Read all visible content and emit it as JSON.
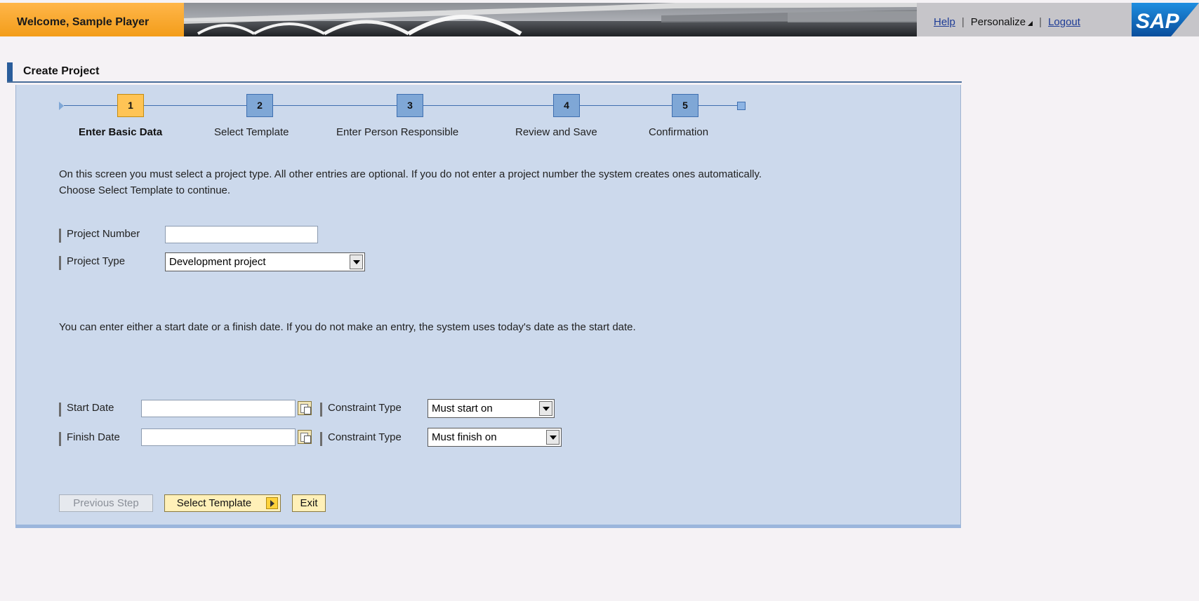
{
  "header": {
    "welcome": "Welcome, Sample Player",
    "links": {
      "help": "Help",
      "personalize": "Personalize",
      "logout": "Logout"
    },
    "logo_text": "SAP"
  },
  "page": {
    "title": "Create Project"
  },
  "roadmap": {
    "current_step": 1,
    "steps": [
      {
        "number": "1",
        "label": "Enter Basic Data"
      },
      {
        "number": "2",
        "label": "Select Template"
      },
      {
        "number": "3",
        "label": "Enter Person Responsible"
      },
      {
        "number": "4",
        "label": "Review and Save"
      },
      {
        "number": "5",
        "label": "Confirmation"
      }
    ]
  },
  "intro": {
    "line1": "On this screen you must select a project type. All other entries are optional. If you do not enter a project number the system creates ones automatically.",
    "line2": "Choose Select Template to continue."
  },
  "form": {
    "project_number": {
      "label": "Project Number",
      "value": ""
    },
    "project_type": {
      "label": "Project Type",
      "value": "Development project"
    }
  },
  "date_info": "You can enter either a start date or a finish date. If you do not make an entry, the system uses today's date as the start date.",
  "dates": {
    "start": {
      "label": "Start Date",
      "value": "",
      "constraint_label": "Constraint Type",
      "constraint_value": "Must start on"
    },
    "finish": {
      "label": "Finish Date",
      "value": "",
      "constraint_label": "Constraint Type",
      "constraint_value": "Must finish on"
    }
  },
  "buttons": {
    "previous": "Previous Step",
    "next": "Select Template",
    "exit": "Exit"
  },
  "colors": {
    "welcome_bg": "#f39d1a",
    "panel_bg": "#ccd9ec",
    "active_step": "#ffc455",
    "inactive_step": "#7fa7d6",
    "link": "#1e3c96"
  }
}
